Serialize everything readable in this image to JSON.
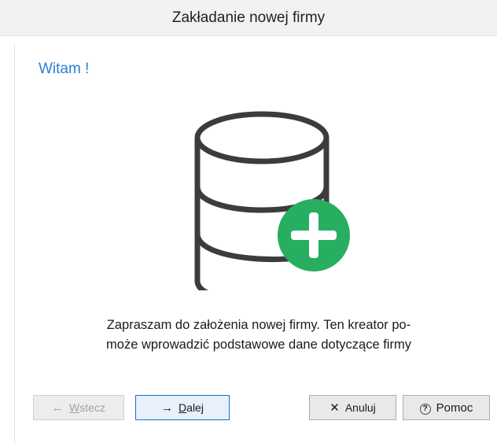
{
  "window": {
    "title": "Zakładanie nowej firmy"
  },
  "page": {
    "greeting": "Witam !",
    "message_line1": "Zapraszam do założenia nowej firmy. Ten kreator po-",
    "message_line2": "może wprowadzić podstawowe dane dotyczące firmy"
  },
  "icons": {
    "hero": "database-add-icon",
    "back": "arrow-left-icon",
    "next": "arrow-right-icon",
    "cancel": "close-icon",
    "help": "help-circle-icon"
  },
  "buttons": {
    "back_prefix": "",
    "back_accel": "W",
    "back_rest": "stecz",
    "next_accel": "D",
    "next_rest": "alej",
    "cancel_label": "Anuluj",
    "help_label": "Pomoc"
  },
  "colors": {
    "greeting": "#2a7fd4",
    "plus_badge": "#27ae60",
    "database_outline": "#3c3c3c"
  }
}
